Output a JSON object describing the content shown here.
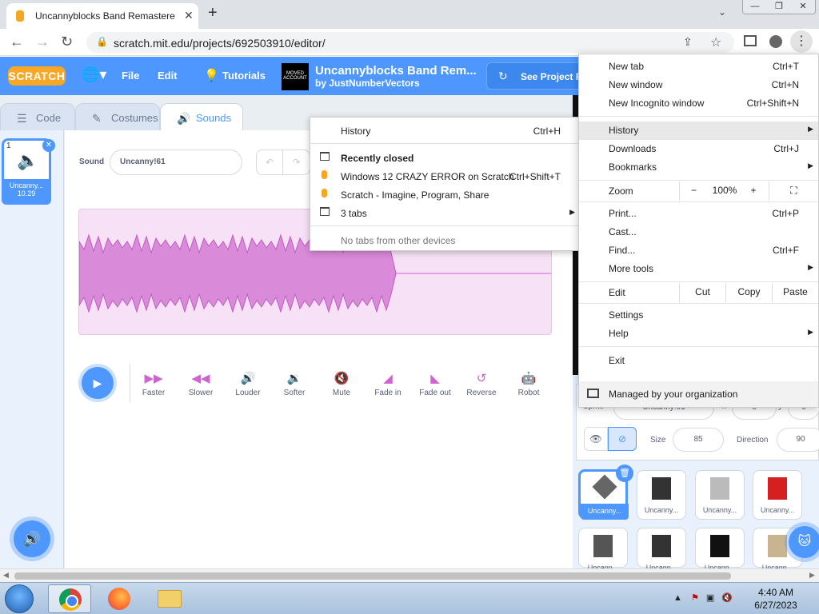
{
  "browser": {
    "tab_title": "Uncannyblocks Band Remastere",
    "tab_close": "✕",
    "new_tab": "+",
    "tab_search": "⌄",
    "url": "scratch.mit.edu/projects/692503910/editor/",
    "window_controls": [
      "—",
      "❐",
      "✕"
    ]
  },
  "scratch": {
    "logo": "SCRATCH",
    "menu": {
      "file": "File",
      "edit": "Edit",
      "tutorials": "Tutorials"
    },
    "project_thumb": "MOVED ACCOUNT",
    "project_title": "Uncannyblocks Band Rem...",
    "project_by": "by JustNumberVectors",
    "see_project": "See Project P",
    "tabs": {
      "code": "Code",
      "costumes": "Costumes",
      "sounds": "Sounds"
    },
    "sound_tile": {
      "number": "1",
      "name": "Uncanny...",
      "duration": "10.29"
    },
    "sound_label": "Sound",
    "sound_name": "Uncanny!61",
    "effects": [
      "Faster",
      "Slower",
      "Louder",
      "Softer",
      "Mute",
      "Fade in",
      "Fade out",
      "Reverse",
      "Robot"
    ],
    "sprite_info": {
      "sprite_label": "Sprite",
      "sprite_name": "Uncanny!61",
      "x_label": "x",
      "x_value": "0",
      "y_label": "y",
      "y_value": "0",
      "size_label": "Size",
      "size_value": "85",
      "direction_label": "Direction",
      "direction_value": "90"
    },
    "sprites": [
      "Uncanny...",
      "Uncanny...",
      "Uncanny...",
      "Uncanny...",
      "Uncann...",
      "Uncann...",
      "Uncann...",
      "Uncann..."
    ]
  },
  "history_menu": {
    "history": "History",
    "history_shortcut": "Ctrl+H",
    "recently_closed": "Recently closed",
    "items": [
      {
        "label": "Windows 12 CRAZY ERROR on Scratch",
        "shortcut": "Ctrl+Shift+T"
      },
      {
        "label": "Scratch - Imagine, Program, Share",
        "shortcut": ""
      }
    ],
    "tabs_group": "3 tabs",
    "no_tabs": "No tabs from other devices"
  },
  "chrome_menu": {
    "new_tab": "New tab",
    "new_tab_sc": "Ctrl+T",
    "new_window": "New window",
    "new_window_sc": "Ctrl+N",
    "incognito": "New Incognito window",
    "incognito_sc": "Ctrl+Shift+N",
    "history": "History",
    "downloads": "Downloads",
    "downloads_sc": "Ctrl+J",
    "bookmarks": "Bookmarks",
    "zoom": "Zoom",
    "zoom_minus": "−",
    "zoom_value": "100%",
    "zoom_plus": "+",
    "print": "Print...",
    "print_sc": "Ctrl+P",
    "cast": "Cast...",
    "find": "Find...",
    "find_sc": "Ctrl+F",
    "more_tools": "More tools",
    "edit": "Edit",
    "cut": "Cut",
    "copy": "Copy",
    "paste": "Paste",
    "settings": "Settings",
    "help": "Help",
    "exit": "Exit",
    "managed": "Managed by your organization"
  },
  "taskbar": {
    "clock_time": "4:40 AM",
    "clock_date": "6/27/2023"
  },
  "colors": {
    "scratch_blue": "#4d97ff",
    "sound_magenta": "#cf63cf",
    "waveform_bg": "#f7e1f6"
  }
}
